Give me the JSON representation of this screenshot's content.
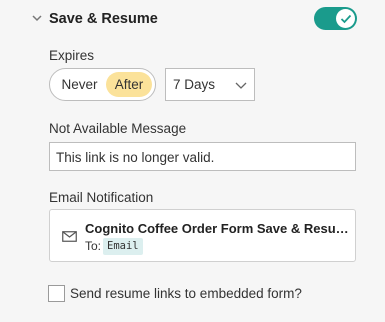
{
  "section": {
    "title": "Save & Resume",
    "toggle_on": true
  },
  "expires": {
    "label": "Expires",
    "options": [
      "Never",
      "After"
    ],
    "selected": "After",
    "duration_value": "7 Days"
  },
  "not_available": {
    "label": "Not Available Message",
    "value": "This link is no longer valid."
  },
  "email_notification": {
    "label": "Email Notification",
    "subject": "Cognito Coffee Order Form Save & Resume",
    "to_label": "To:",
    "to_value": "Email"
  },
  "embedded": {
    "label": "Send resume links to embedded form?",
    "checked": false
  },
  "colors": {
    "toggle": "#1a9b8c",
    "selected_option": "#fbe29a",
    "badge": "#dcefef"
  }
}
